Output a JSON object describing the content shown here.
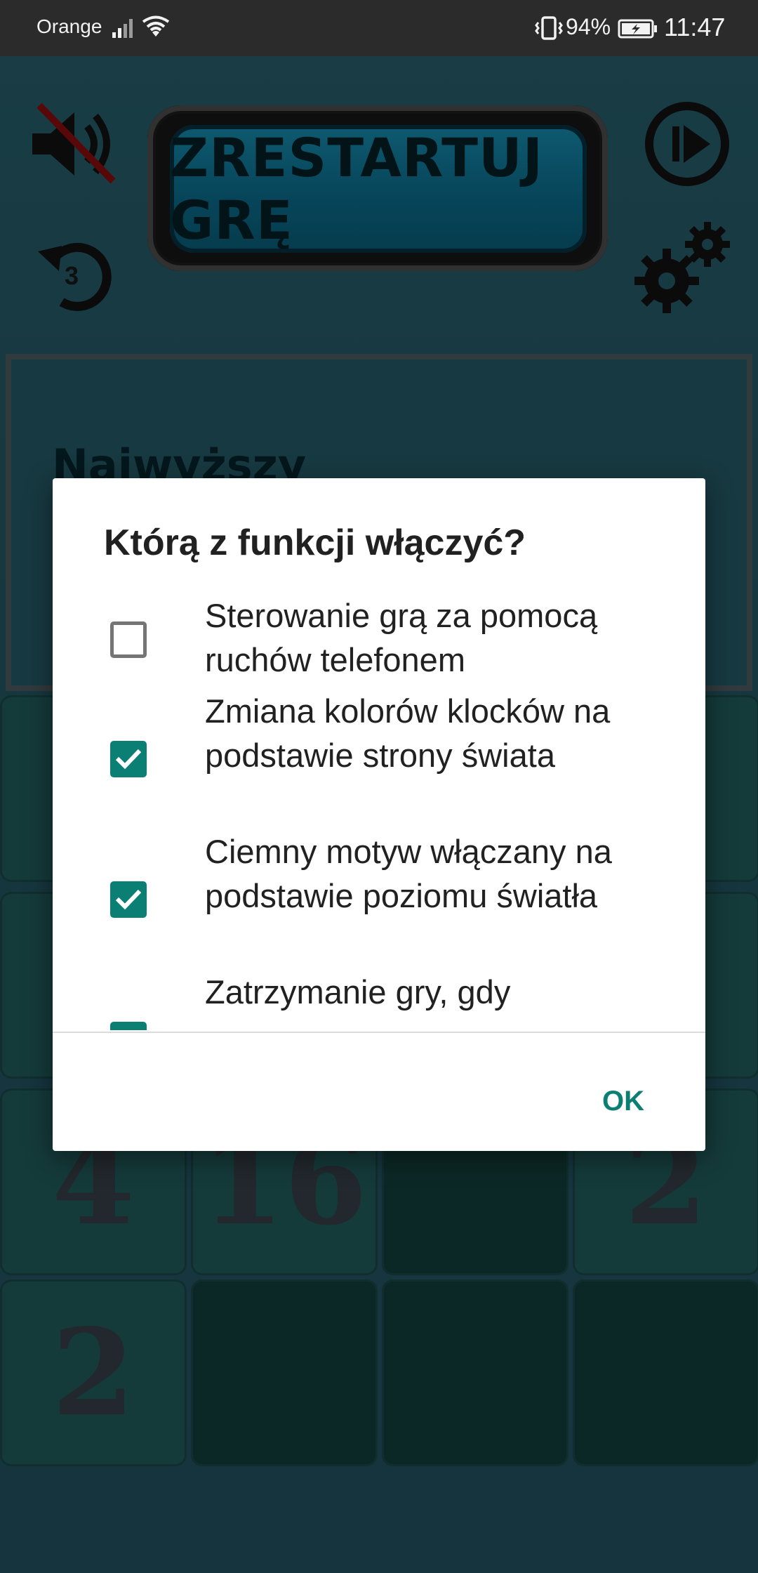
{
  "status_bar": {
    "carrier": "Orange",
    "battery_percent": "94%",
    "time": "11:47"
  },
  "game": {
    "restart_label": "ZRESTARTUJ GRĘ",
    "undo_count": "3",
    "score_label": "Najwyższy",
    "tiles": [
      {
        "value": "4"
      },
      {
        "value": "16"
      },
      {
        "value": ""
      },
      {
        "value": "2"
      },
      {
        "value": "2"
      },
      {
        "value": ""
      },
      {
        "value": ""
      },
      {
        "value": ""
      }
    ]
  },
  "dialog": {
    "title": "Którą z funkcji włączyć?",
    "options": [
      {
        "label": "Sterowanie grą za pomocą ruchów telefonem",
        "checked": false
      },
      {
        "label": "Zmiana kolorów klocków na podstawie strony świata",
        "checked": true
      },
      {
        "label": "Ciemny motyw włączany na podstawie poziomu światła",
        "checked": true
      },
      {
        "label": "Zatrzymanie gry, gdy",
        "checked": true
      }
    ],
    "ok_label": "OK"
  },
  "colors": {
    "accent": "#0b7f73",
    "restart_button": "#1aa4cc"
  }
}
